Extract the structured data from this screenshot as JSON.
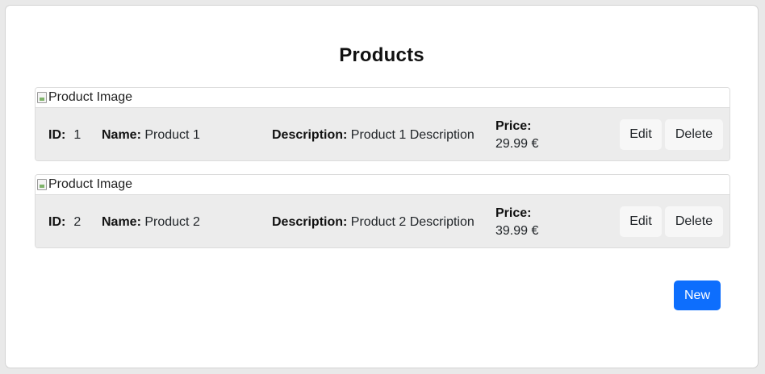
{
  "page": {
    "title": "Products",
    "new_button": "New"
  },
  "labels": {
    "id": "ID:",
    "name": "Name:",
    "description": "Description:",
    "price": "Price:",
    "edit": "Edit",
    "delete": "Delete",
    "image_alt": "Product Image"
  },
  "products": [
    {
      "id": "1",
      "name": "Product 1",
      "description": "Product 1 Description",
      "price": "29.99 €"
    },
    {
      "id": "2",
      "name": "Product 2",
      "description": "Product 2 Description",
      "price": "39.99 €"
    }
  ],
  "colors": {
    "primary": "#0d6efd",
    "card_body_bg": "#ececec",
    "page_bg": "#e9e9e9"
  }
}
